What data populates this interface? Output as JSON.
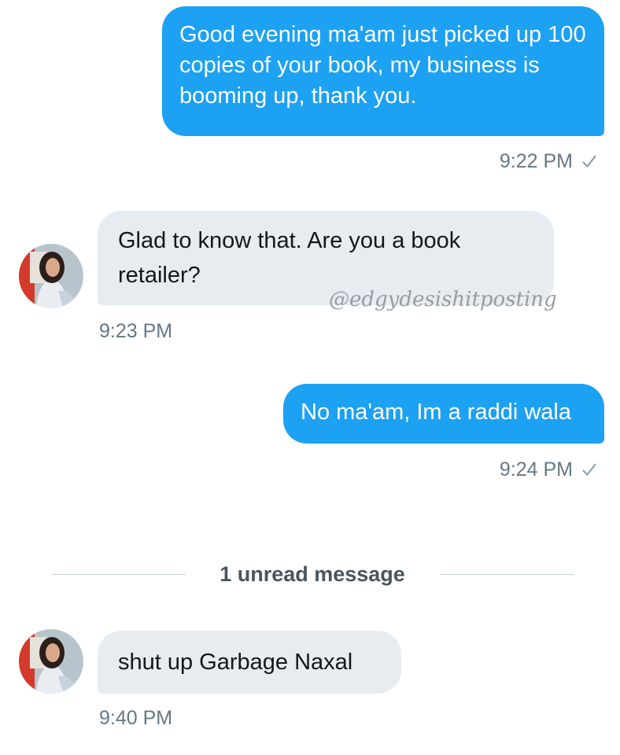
{
  "conversation": {
    "messages": [
      {
        "direction": "outgoing",
        "text": "Good evening ma'am just picked up 100 copies of your book, my business is booming up, thank you.",
        "time": "9:22 PM",
        "status_icon": "check-icon"
      },
      {
        "direction": "incoming",
        "text": "Glad to know that. Are you a book retailer?",
        "time": "9:23 PM"
      },
      {
        "direction": "outgoing",
        "text": "No ma'am, Im a raddi wala",
        "time": "9:24 PM",
        "status_icon": "check-icon"
      },
      {
        "direction": "incoming",
        "text": "shut up Garbage Naxal",
        "time": "9:40 PM"
      }
    ],
    "unread_divider": "1 unread message"
  },
  "watermark": "@edgydesishitposting",
  "colors": {
    "outgoing_bubble": "#1da1f2",
    "incoming_bubble": "#e6ecf0",
    "timestamp": "#657786"
  }
}
